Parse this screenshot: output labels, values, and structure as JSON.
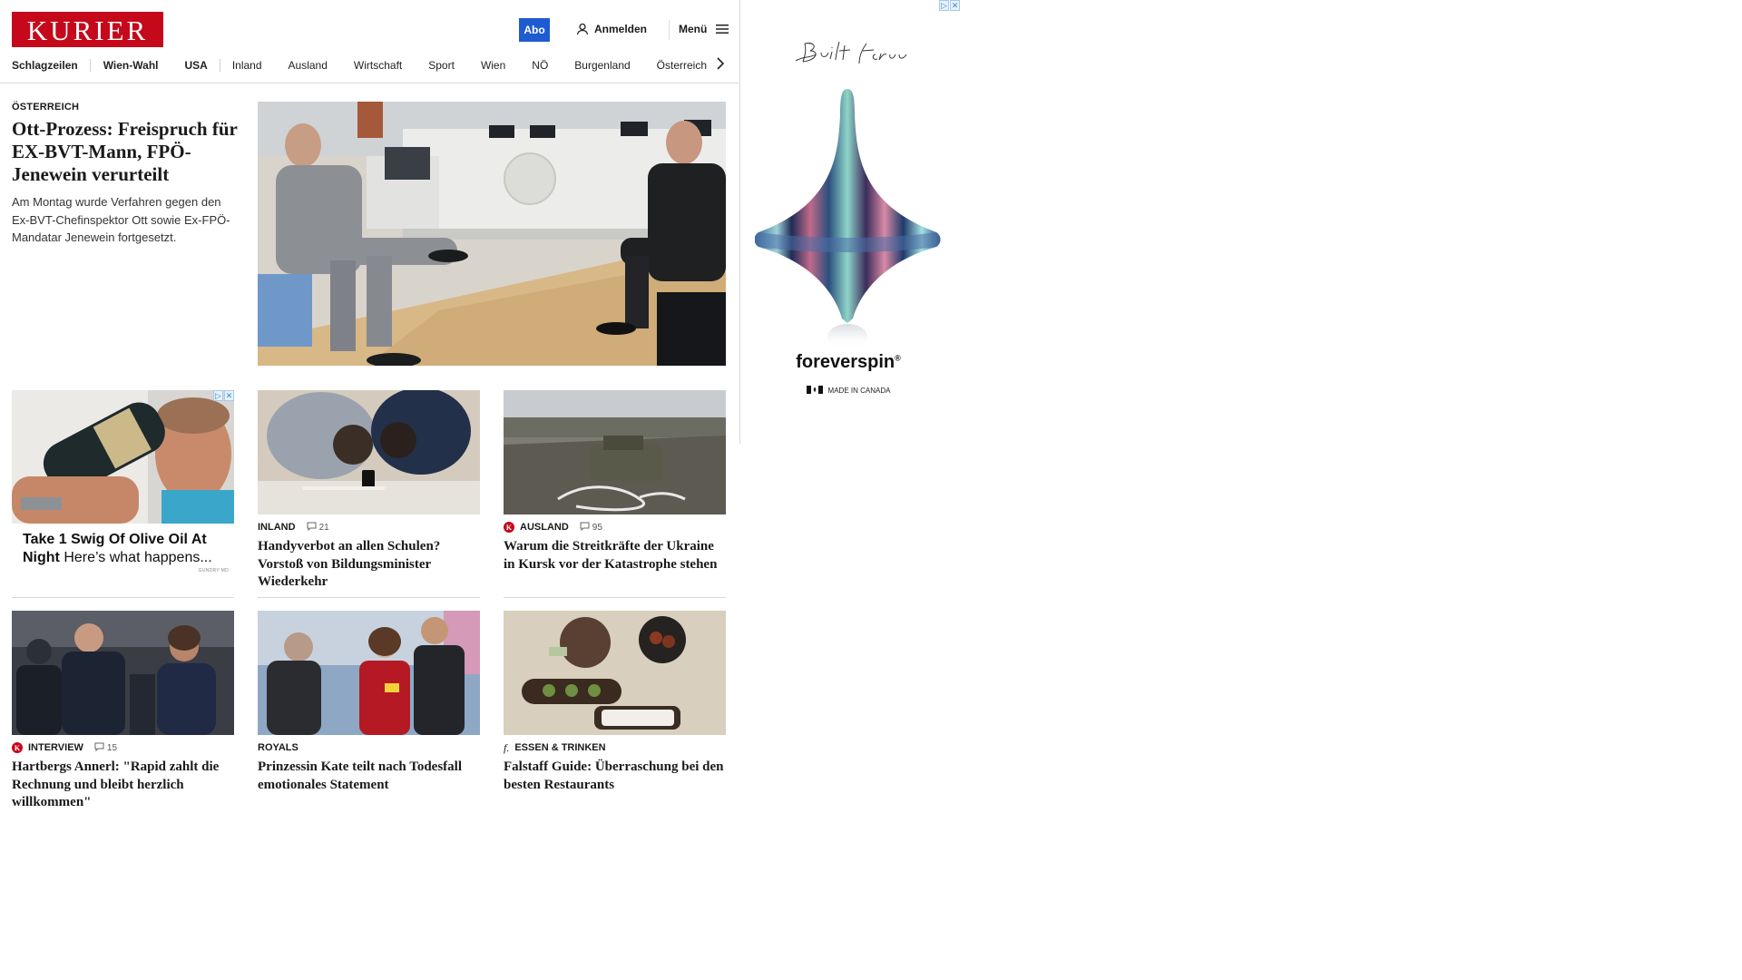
{
  "header": {
    "logo": "KURIER",
    "abo_label": "Abo",
    "login_label": "Anmelden",
    "menu_label": "Menü"
  },
  "nav": {
    "items": [
      "Schlagzeilen",
      "Wien-Wahl",
      "USA",
      "Inland",
      "Ausland",
      "Wirtschaft",
      "Sport",
      "Wien",
      "NÖ",
      "Burgenland",
      "Österreich"
    ]
  },
  "hero": {
    "kicker": "ÖSTERREICH",
    "title": "Ott-Prozess: Freispruch für EX-BVT-Mann, FPÖ-Jenewein verurteilt",
    "lead": "Am Montag wurde Verfahren gegen den Ex-BVT-Chefinspektor Ott sowie Ex-FPÖ-Mandatar Jenewein fortgesetzt."
  },
  "native_ad": {
    "headline_bold": "Take 1 Swig Of Olive Oil At Night",
    "headline_rest": "Here’s what happens...",
    "sponsor": "GUNDRY MD"
  },
  "tiles": [
    {
      "kicker": "INLAND",
      "comments": "21",
      "title": "Handyverbot an allen Schulen? Vorstoß von Bildungsminister Wiederkehr"
    },
    {
      "kicker": "AUSLAND",
      "comments": "95",
      "title": "Warum die Streitkräfte der Ukraine in Kursk vor der Katastrophe stehen"
    },
    {
      "kicker": "INTERVIEW",
      "comments": "15",
      "title": "Hartbergs Annerl: \"Rapid zahlt die Rechnung und bleibt herzlich willkommen\""
    },
    {
      "kicker": "ROYALS",
      "title": "Prinzessin Kate teilt nach Todesfall emotionales Statement"
    },
    {
      "kicker": "ESSEN & TRINKEN",
      "title": "Falstaff Guide: Überraschung bei den besten Restaurants"
    }
  ],
  "badges": {
    "kurier_plus": "K",
    "falstaff": "f."
  },
  "side_ad": {
    "script": "Built forever",
    "brand": "foreverspin",
    "registered": "®",
    "made_in": "MADE IN CANADA"
  },
  "colors": {
    "brand_red": "#c6081b",
    "abo_blue": "#1e5bd1"
  }
}
